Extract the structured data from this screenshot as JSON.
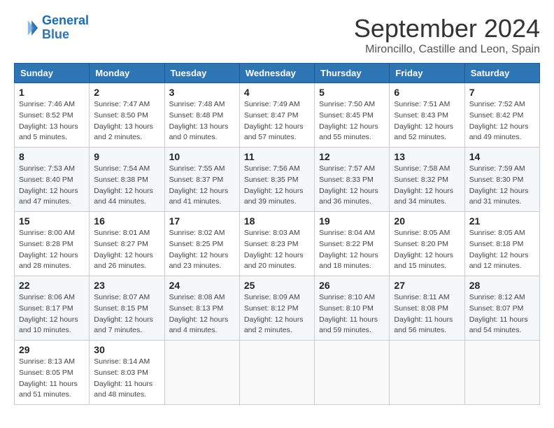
{
  "logo": {
    "line1": "General",
    "line2": "Blue"
  },
  "title": "September 2024",
  "location": "Mironcillo, Castille and Leon, Spain",
  "days_header": [
    "Sunday",
    "Monday",
    "Tuesday",
    "Wednesday",
    "Thursday",
    "Friday",
    "Saturday"
  ],
  "weeks": [
    [
      {
        "day": "1",
        "info": "Sunrise: 7:46 AM\nSunset: 8:52 PM\nDaylight: 13 hours\nand 5 minutes."
      },
      {
        "day": "2",
        "info": "Sunrise: 7:47 AM\nSunset: 8:50 PM\nDaylight: 13 hours\nand 2 minutes."
      },
      {
        "day": "3",
        "info": "Sunrise: 7:48 AM\nSunset: 8:48 PM\nDaylight: 13 hours\nand 0 minutes."
      },
      {
        "day": "4",
        "info": "Sunrise: 7:49 AM\nSunset: 8:47 PM\nDaylight: 12 hours\nand 57 minutes."
      },
      {
        "day": "5",
        "info": "Sunrise: 7:50 AM\nSunset: 8:45 PM\nDaylight: 12 hours\nand 55 minutes."
      },
      {
        "day": "6",
        "info": "Sunrise: 7:51 AM\nSunset: 8:43 PM\nDaylight: 12 hours\nand 52 minutes."
      },
      {
        "day": "7",
        "info": "Sunrise: 7:52 AM\nSunset: 8:42 PM\nDaylight: 12 hours\nand 49 minutes."
      }
    ],
    [
      {
        "day": "8",
        "info": "Sunrise: 7:53 AM\nSunset: 8:40 PM\nDaylight: 12 hours\nand 47 minutes."
      },
      {
        "day": "9",
        "info": "Sunrise: 7:54 AM\nSunset: 8:38 PM\nDaylight: 12 hours\nand 44 minutes."
      },
      {
        "day": "10",
        "info": "Sunrise: 7:55 AM\nSunset: 8:37 PM\nDaylight: 12 hours\nand 41 minutes."
      },
      {
        "day": "11",
        "info": "Sunrise: 7:56 AM\nSunset: 8:35 PM\nDaylight: 12 hours\nand 39 minutes."
      },
      {
        "day": "12",
        "info": "Sunrise: 7:57 AM\nSunset: 8:33 PM\nDaylight: 12 hours\nand 36 minutes."
      },
      {
        "day": "13",
        "info": "Sunrise: 7:58 AM\nSunset: 8:32 PM\nDaylight: 12 hours\nand 34 minutes."
      },
      {
        "day": "14",
        "info": "Sunrise: 7:59 AM\nSunset: 8:30 PM\nDaylight: 12 hours\nand 31 minutes."
      }
    ],
    [
      {
        "day": "15",
        "info": "Sunrise: 8:00 AM\nSunset: 8:28 PM\nDaylight: 12 hours\nand 28 minutes."
      },
      {
        "day": "16",
        "info": "Sunrise: 8:01 AM\nSunset: 8:27 PM\nDaylight: 12 hours\nand 26 minutes."
      },
      {
        "day": "17",
        "info": "Sunrise: 8:02 AM\nSunset: 8:25 PM\nDaylight: 12 hours\nand 23 minutes."
      },
      {
        "day": "18",
        "info": "Sunrise: 8:03 AM\nSunset: 8:23 PM\nDaylight: 12 hours\nand 20 minutes."
      },
      {
        "day": "19",
        "info": "Sunrise: 8:04 AM\nSunset: 8:22 PM\nDaylight: 12 hours\nand 18 minutes."
      },
      {
        "day": "20",
        "info": "Sunrise: 8:05 AM\nSunset: 8:20 PM\nDaylight: 12 hours\nand 15 minutes."
      },
      {
        "day": "21",
        "info": "Sunrise: 8:05 AM\nSunset: 8:18 PM\nDaylight: 12 hours\nand 12 minutes."
      }
    ],
    [
      {
        "day": "22",
        "info": "Sunrise: 8:06 AM\nSunset: 8:17 PM\nDaylight: 12 hours\nand 10 minutes."
      },
      {
        "day": "23",
        "info": "Sunrise: 8:07 AM\nSunset: 8:15 PM\nDaylight: 12 hours\nand 7 minutes."
      },
      {
        "day": "24",
        "info": "Sunrise: 8:08 AM\nSunset: 8:13 PM\nDaylight: 12 hours\nand 4 minutes."
      },
      {
        "day": "25",
        "info": "Sunrise: 8:09 AM\nSunset: 8:12 PM\nDaylight: 12 hours\nand 2 minutes."
      },
      {
        "day": "26",
        "info": "Sunrise: 8:10 AM\nSunset: 8:10 PM\nDaylight: 11 hours\nand 59 minutes."
      },
      {
        "day": "27",
        "info": "Sunrise: 8:11 AM\nSunset: 8:08 PM\nDaylight: 11 hours\nand 56 minutes."
      },
      {
        "day": "28",
        "info": "Sunrise: 8:12 AM\nSunset: 8:07 PM\nDaylight: 11 hours\nand 54 minutes."
      }
    ],
    [
      {
        "day": "29",
        "info": "Sunrise: 8:13 AM\nSunset: 8:05 PM\nDaylight: 11 hours\nand 51 minutes."
      },
      {
        "day": "30",
        "info": "Sunrise: 8:14 AM\nSunset: 8:03 PM\nDaylight: 11 hours\nand 48 minutes."
      },
      {
        "day": "",
        "info": ""
      },
      {
        "day": "",
        "info": ""
      },
      {
        "day": "",
        "info": ""
      },
      {
        "day": "",
        "info": ""
      },
      {
        "day": "",
        "info": ""
      }
    ]
  ]
}
